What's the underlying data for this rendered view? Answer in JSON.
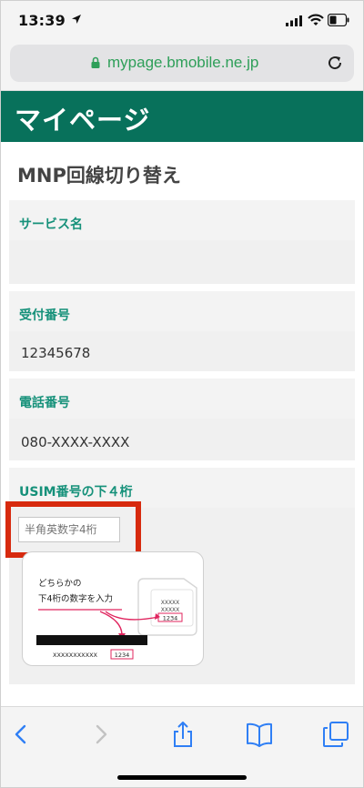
{
  "status_bar": {
    "time": "13:39"
  },
  "browser": {
    "url": "mypage.bmobile.ne.jp"
  },
  "header": {
    "title": "マイページ"
  },
  "page": {
    "section_title": "MNP回線切り替え"
  },
  "fields": {
    "service_name": {
      "label": "サービス名",
      "value": ""
    },
    "reception_number": {
      "label": "受付番号",
      "value": "12345678"
    },
    "phone_number": {
      "label": "電話番号",
      "value": "080-XXXX-XXXX"
    },
    "usim": {
      "label": "USIM番号の下４桁",
      "placeholder": "半角英数字4桁",
      "value": ""
    }
  },
  "illustration": {
    "text_line1": "どちらかの",
    "text_line2": "下4桁の数字を入力",
    "card_code_mask": "XXXXX",
    "card_code_digits": "1234",
    "long_code_mask": "XXXXXXXXXXX",
    "long_code_digits": "1234"
  },
  "colors": {
    "header_bg": "#08715b",
    "label_teal": "#16917a",
    "highlight_red": "#d72a0e",
    "ios_blue": "#2f7ff5",
    "url_green": "#2e9f59"
  }
}
